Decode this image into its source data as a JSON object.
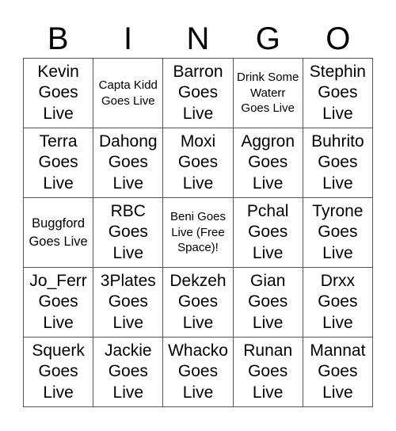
{
  "header": {
    "letters": [
      "B",
      "I",
      "N",
      "G",
      "O"
    ]
  },
  "cells": [
    "Kevin Goes Live",
    "Capta Kidd Goes Live",
    "Barron Goes Live",
    "Drink Some Waterr Goes Live",
    "Stephin Goes Live",
    "Terra Goes Live",
    "Dahong Goes Live",
    "Moxi Goes Live",
    "Aggron Goes Live",
    "Buhrito Goes Live",
    "Buggford Goes Live",
    "RBC Goes Live",
    "Beni Goes Live (Free Space)!",
    "Pchal Goes Live",
    "Tyrone Goes Live",
    "Jo_Ferr Goes Live",
    "3Plates Goes Live",
    "Dekzeh Goes Live",
    "Gian Goes Live",
    "Drxx Goes Live",
    "Squerk Goes Live",
    "Jackie Goes Live",
    "Whacko Goes Live",
    "Runan Goes Live",
    "Mannat Goes Live"
  ],
  "free_space_index": 12
}
